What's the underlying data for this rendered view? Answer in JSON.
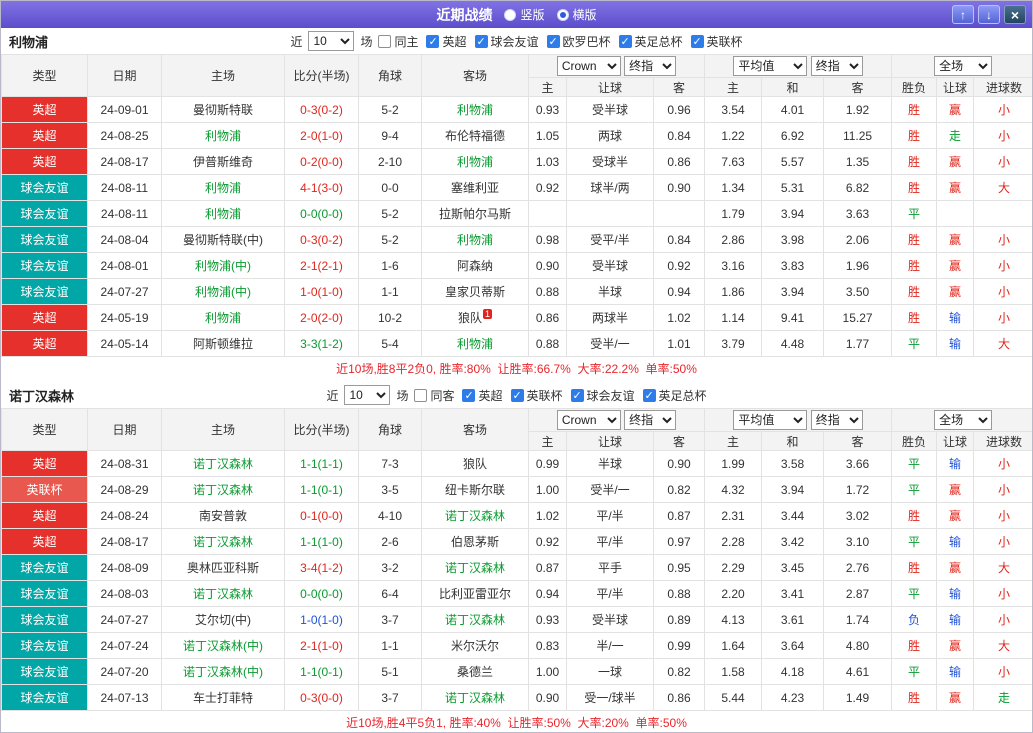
{
  "titlebar": {
    "title": "近期战绩",
    "layout_options": [
      {
        "label": "竖版",
        "selected": false
      },
      {
        "label": "横版",
        "selected": true
      }
    ],
    "up_icon": "↑",
    "down_icon": "↓",
    "close_icon": "×"
  },
  "thead": {
    "main": [
      "类型",
      "日期",
      "主场",
      "比分(半场)",
      "角球",
      "客场"
    ],
    "sub": [
      "主",
      "让球",
      "客",
      "主",
      "和",
      "客",
      "胜负",
      "让球",
      "进球数"
    ],
    "company": "Crown",
    "final1": "终指",
    "average": "平均值",
    "final2": "终指",
    "scope": "全场"
  },
  "colors": {
    "win_red": "#e0261c",
    "draw_green": "#089b2f",
    "lose_blue": "#2052d3",
    "epl_badge": "#e5302c",
    "league_cup_badge": "#e8584e",
    "friendly_badge": "#01a7a7",
    "titlebar_purple": "#6a5cd6"
  },
  "sections": [
    {
      "team": "利物浦",
      "filter": {
        "near": "近",
        "count": "10",
        "games": "场",
        "checkboxes": [
          {
            "label": "同主",
            "checked": false
          },
          {
            "label": "英超",
            "checked": true
          },
          {
            "label": "球会友谊",
            "checked": true
          },
          {
            "label": "欧罗巴杯",
            "checked": true
          },
          {
            "label": "英足总杯",
            "checked": true
          },
          {
            "label": "英联杯",
            "checked": true
          }
        ]
      },
      "rows": [
        {
          "type": "英超",
          "cls": "epl",
          "date": "24-09-01",
          "home": "曼彻斯特联",
          "hf": false,
          "score": "0-3(0-2)",
          "sc": "red",
          "corner": "5-2",
          "away": "利物浦",
          "af": true,
          "asia": [
            "0.93",
            "受半球",
            "0.96"
          ],
          "euro": [
            "3.54",
            "4.01",
            "1.92"
          ],
          "res": [
            {
              "t": "胜",
              "c": "red"
            },
            {
              "t": "赢",
              "c": "red"
            },
            {
              "t": "小",
              "c": "red"
            }
          ]
        },
        {
          "type": "英超",
          "cls": "epl",
          "date": "24-08-25",
          "home": "利物浦",
          "hf": true,
          "score": "2-0(1-0)",
          "sc": "red",
          "corner": "9-4",
          "away": "布伦特福德",
          "af": false,
          "asia": [
            "1.05",
            "两球",
            "0.84"
          ],
          "euro": [
            "1.22",
            "6.92",
            "11.25"
          ],
          "res": [
            {
              "t": "胜",
              "c": "red"
            },
            {
              "t": "走",
              "c": "green"
            },
            {
              "t": "小",
              "c": "red"
            }
          ]
        },
        {
          "type": "英超",
          "cls": "epl",
          "date": "24-08-17",
          "home": "伊普斯维奇",
          "hf": false,
          "score": "0-2(0-0)",
          "sc": "red",
          "corner": "2-10",
          "away": "利物浦",
          "af": true,
          "asia": [
            "1.03",
            "受球半",
            "0.86"
          ],
          "euro": [
            "7.63",
            "5.57",
            "1.35"
          ],
          "res": [
            {
              "t": "胜",
              "c": "red"
            },
            {
              "t": "赢",
              "c": "red"
            },
            {
              "t": "小",
              "c": "red"
            }
          ]
        },
        {
          "type": "球会友谊",
          "cls": "fr",
          "date": "24-08-11",
          "home": "利物浦",
          "hf": true,
          "score": "4-1(3-0)",
          "sc": "red",
          "corner": "0-0",
          "away": "塞维利亚",
          "af": false,
          "asia": [
            "0.92",
            "球半/两",
            "0.90"
          ],
          "euro": [
            "1.34",
            "5.31",
            "6.82"
          ],
          "res": [
            {
              "t": "胜",
              "c": "red"
            },
            {
              "t": "赢",
              "c": "red"
            },
            {
              "t": "大",
              "c": "red"
            }
          ]
        },
        {
          "type": "球会友谊",
          "cls": "fr",
          "date": "24-08-11",
          "home": "利物浦",
          "hf": true,
          "score": "0-0(0-0)",
          "sc": "green",
          "corner": "5-2",
          "away": "拉斯帕尔马斯",
          "af": false,
          "asia": [
            "",
            "",
            ""
          ],
          "euro": [
            "1.79",
            "3.94",
            "3.63"
          ],
          "res": [
            {
              "t": "平",
              "c": "green"
            },
            {
              "t": "",
              "c": ""
            },
            {
              "t": "",
              "c": ""
            }
          ]
        },
        {
          "type": "球会友谊",
          "cls": "fr",
          "date": "24-08-04",
          "home": "曼彻斯特联(中)",
          "hf": false,
          "score": "0-3(0-2)",
          "sc": "red",
          "corner": "5-2",
          "away": "利物浦",
          "af": true,
          "asia": [
            "0.98",
            "受平/半",
            "0.84"
          ],
          "euro": [
            "2.86",
            "3.98",
            "2.06"
          ],
          "res": [
            {
              "t": "胜",
              "c": "red"
            },
            {
              "t": "赢",
              "c": "red"
            },
            {
              "t": "小",
              "c": "red"
            }
          ]
        },
        {
          "type": "球会友谊",
          "cls": "fr",
          "date": "24-08-01",
          "home": "利物浦(中)",
          "hf": true,
          "score": "2-1(2-1)",
          "sc": "red",
          "corner": "1-6",
          "away": "阿森纳",
          "af": false,
          "asia": [
            "0.90",
            "受半球",
            "0.92"
          ],
          "euro": [
            "3.16",
            "3.83",
            "1.96"
          ],
          "res": [
            {
              "t": "胜",
              "c": "red"
            },
            {
              "t": "赢",
              "c": "red"
            },
            {
              "t": "小",
              "c": "red"
            }
          ]
        },
        {
          "type": "球会友谊",
          "cls": "fr",
          "date": "24-07-27",
          "home": "利物浦(中)",
          "hf": true,
          "score": "1-0(1-0)",
          "sc": "red",
          "corner": "1-1",
          "away": "皇家贝蒂斯",
          "af": false,
          "asia": [
            "0.88",
            "半球",
            "0.94"
          ],
          "euro": [
            "1.86",
            "3.94",
            "3.50"
          ],
          "res": [
            {
              "t": "胜",
              "c": "red"
            },
            {
              "t": "赢",
              "c": "red"
            },
            {
              "t": "小",
              "c": "red"
            }
          ]
        },
        {
          "type": "英超",
          "cls": "epl",
          "date": "24-05-19",
          "home": "利物浦",
          "hf": true,
          "score": "2-0(2-0)",
          "sc": "red",
          "corner": "10-2",
          "away": "狼队",
          "af": false,
          "ab": "1",
          "asia": [
            "0.86",
            "两球半",
            "1.02"
          ],
          "euro": [
            "1.14",
            "9.41",
            "15.27"
          ],
          "res": [
            {
              "t": "胜",
              "c": "red"
            },
            {
              "t": "输",
              "c": "blue"
            },
            {
              "t": "小",
              "c": "red"
            }
          ]
        },
        {
          "type": "英超",
          "cls": "epl",
          "date": "24-05-14",
          "home": "阿斯顿维拉",
          "hf": false,
          "score": "3-3(1-2)",
          "sc": "green",
          "corner": "5-4",
          "away": "利物浦",
          "af": true,
          "asia": [
            "0.88",
            "受半/一",
            "1.01"
          ],
          "euro": [
            "3.79",
            "4.48",
            "1.77"
          ],
          "res": [
            {
              "t": "平",
              "c": "green"
            },
            {
              "t": "输",
              "c": "blue"
            },
            {
              "t": "大",
              "c": "red"
            }
          ]
        }
      ],
      "summary": "近10场,胜8平2负0, 胜率:80%  让胜率:66.7%  大率:22.2%  单率:50%"
    },
    {
      "team": "诺丁汉森林",
      "filter": {
        "near": "近",
        "count": "10",
        "games": "场",
        "checkboxes": [
          {
            "label": "同客",
            "checked": false
          },
          {
            "label": "英超",
            "checked": true
          },
          {
            "label": "英联杯",
            "checked": true
          },
          {
            "label": "球会友谊",
            "checked": true
          },
          {
            "label": "英足总杯",
            "checked": true
          }
        ]
      },
      "rows": [
        {
          "type": "英超",
          "cls": "epl",
          "date": "24-08-31",
          "home": "诺丁汉森林",
          "hf": true,
          "score": "1-1(1-1)",
          "sc": "green",
          "corner": "7-3",
          "away": "狼队",
          "af": false,
          "asia": [
            "0.99",
            "半球",
            "0.90"
          ],
          "euro": [
            "1.99",
            "3.58",
            "3.66"
          ],
          "res": [
            {
              "t": "平",
              "c": "green"
            },
            {
              "t": "输",
              "c": "blue"
            },
            {
              "t": "小",
              "c": "red"
            }
          ]
        },
        {
          "type": "英联杯",
          "cls": "lc",
          "date": "24-08-29",
          "home": "诺丁汉森林",
          "hf": true,
          "score": "1-1(0-1)",
          "sc": "green",
          "corner": "3-5",
          "away": "纽卡斯尔联",
          "af": false,
          "asia": [
            "1.00",
            "受半/一",
            "0.82"
          ],
          "euro": [
            "4.32",
            "3.94",
            "1.72"
          ],
          "res": [
            {
              "t": "平",
              "c": "green"
            },
            {
              "t": "赢",
              "c": "red"
            },
            {
              "t": "小",
              "c": "red"
            }
          ]
        },
        {
          "type": "英超",
          "cls": "epl",
          "date": "24-08-24",
          "home": "南安普敦",
          "hf": false,
          "score": "0-1(0-0)",
          "sc": "red",
          "corner": "4-10",
          "away": "诺丁汉森林",
          "af": true,
          "asia": [
            "1.02",
            "平/半",
            "0.87"
          ],
          "euro": [
            "2.31",
            "3.44",
            "3.02"
          ],
          "res": [
            {
              "t": "胜",
              "c": "red"
            },
            {
              "t": "赢",
              "c": "red"
            },
            {
              "t": "小",
              "c": "red"
            }
          ]
        },
        {
          "type": "英超",
          "cls": "epl",
          "date": "24-08-17",
          "home": "诺丁汉森林",
          "hf": true,
          "score": "1-1(1-0)",
          "sc": "green",
          "corner": "2-6",
          "away": "伯恩茅斯",
          "af": false,
          "asia": [
            "0.92",
            "平/半",
            "0.97"
          ],
          "euro": [
            "2.28",
            "3.42",
            "3.10"
          ],
          "res": [
            {
              "t": "平",
              "c": "green"
            },
            {
              "t": "输",
              "c": "blue"
            },
            {
              "t": "小",
              "c": "red"
            }
          ]
        },
        {
          "type": "球会友谊",
          "cls": "fr",
          "date": "24-08-09",
          "home": "奥林匹亚科斯",
          "hf": false,
          "score": "3-4(1-2)",
          "sc": "red",
          "corner": "3-2",
          "away": "诺丁汉森林",
          "af": true,
          "asia": [
            "0.87",
            "平手",
            "0.95"
          ],
          "euro": [
            "2.29",
            "3.45",
            "2.76"
          ],
          "res": [
            {
              "t": "胜",
              "c": "red"
            },
            {
              "t": "赢",
              "c": "red"
            },
            {
              "t": "大",
              "c": "red"
            }
          ]
        },
        {
          "type": "球会友谊",
          "cls": "fr",
          "date": "24-08-03",
          "home": "诺丁汉森林",
          "hf": true,
          "score": "0-0(0-0)",
          "sc": "green",
          "corner": "6-4",
          "away": "比利亚雷亚尔",
          "af": false,
          "asia": [
            "0.94",
            "平/半",
            "0.88"
          ],
          "euro": [
            "2.20",
            "3.41",
            "2.87"
          ],
          "res": [
            {
              "t": "平",
              "c": "green"
            },
            {
              "t": "输",
              "c": "blue"
            },
            {
              "t": "小",
              "c": "red"
            }
          ]
        },
        {
          "type": "球会友谊",
          "cls": "fr",
          "date": "24-07-27",
          "home": "艾尔切(中)",
          "hf": false,
          "score": "1-0(1-0)",
          "sc": "blue",
          "corner": "3-7",
          "away": "诺丁汉森林",
          "af": true,
          "asia": [
            "0.93",
            "受半球",
            "0.89"
          ],
          "euro": [
            "4.13",
            "3.61",
            "1.74"
          ],
          "res": [
            {
              "t": "负",
              "c": "blue"
            },
            {
              "t": "输",
              "c": "blue"
            },
            {
              "t": "小",
              "c": "red"
            }
          ]
        },
        {
          "type": "球会友谊",
          "cls": "fr",
          "date": "24-07-24",
          "home": "诺丁汉森林(中)",
          "hf": true,
          "score": "2-1(1-0)",
          "sc": "red",
          "corner": "1-1",
          "away": "米尔沃尔",
          "af": false,
          "asia": [
            "0.83",
            "半/一",
            "0.99"
          ],
          "euro": [
            "1.64",
            "3.64",
            "4.80"
          ],
          "res": [
            {
              "t": "胜",
              "c": "red"
            },
            {
              "t": "赢",
              "c": "red"
            },
            {
              "t": "大",
              "c": "red"
            }
          ]
        },
        {
          "type": "球会友谊",
          "cls": "fr",
          "date": "24-07-20",
          "home": "诺丁汉森林(中)",
          "hf": true,
          "score": "1-1(0-1)",
          "sc": "green",
          "corner": "5-1",
          "away": "桑德兰",
          "af": false,
          "asia": [
            "1.00",
            "一球",
            "0.82"
          ],
          "euro": [
            "1.58",
            "4.18",
            "4.61"
          ],
          "res": [
            {
              "t": "平",
              "c": "green"
            },
            {
              "t": "输",
              "c": "blue"
            },
            {
              "t": "小",
              "c": "red"
            }
          ]
        },
        {
          "type": "球会友谊",
          "cls": "fr",
          "date": "24-07-13",
          "home": "车士打菲特",
          "hf": false,
          "score": "0-3(0-0)",
          "sc": "red",
          "corner": "3-7",
          "away": "诺丁汉森林",
          "af": true,
          "asia": [
            "0.90",
            "受一/球半",
            "0.86"
          ],
          "euro": [
            "5.44",
            "4.23",
            "1.49"
          ],
          "res": [
            {
              "t": "胜",
              "c": "red"
            },
            {
              "t": "赢",
              "c": "red"
            },
            {
              "t": "走",
              "c": "green"
            }
          ]
        }
      ],
      "summary": "近10场,胜4平5负1, 胜率:40%  让胜率:50%  大率:20%  单率:50%"
    }
  ]
}
